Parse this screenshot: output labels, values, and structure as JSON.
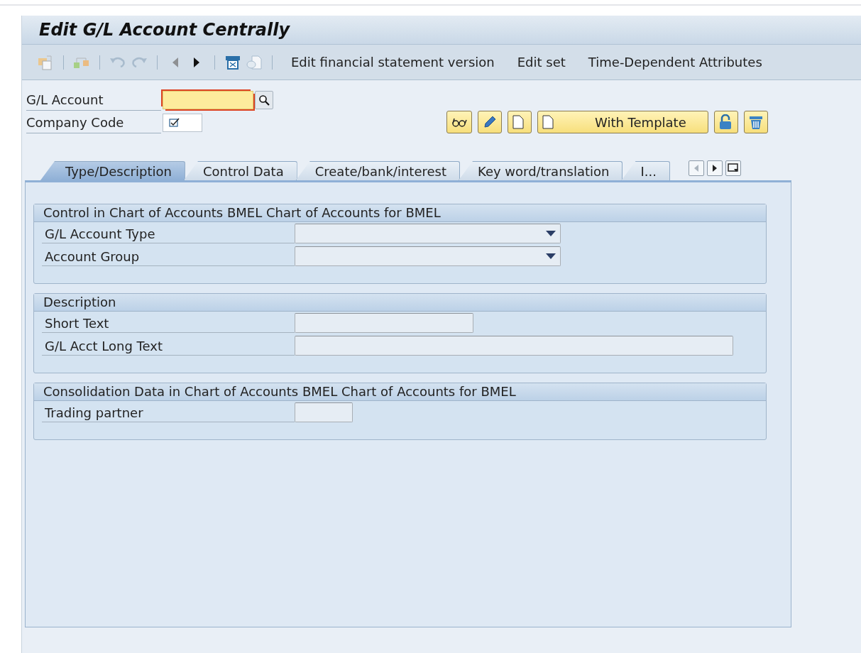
{
  "title": "Edit G/L Account Centrally",
  "toolbar": {
    "groups": [
      [
        {
          "kind": "copy",
          "disabled": true
        }
      ],
      [
        {
          "kind": "hierarchy",
          "disabled": true
        }
      ],
      [
        {
          "kind": "undo",
          "disabled": true
        },
        {
          "kind": "redo",
          "disabled": true
        }
      ],
      [
        {
          "kind": "prev",
          "disabled": true
        },
        {
          "kind": "next",
          "disabled": false
        }
      ],
      [
        {
          "kind": "print",
          "disabled": false
        },
        {
          "kind": "document",
          "disabled": true
        }
      ]
    ],
    "links": [
      "Edit financial statement version",
      "Edit set",
      "Time-Dependent Attributes"
    ]
  },
  "header_fields": [
    {
      "label": "G/L Account",
      "focused": true,
      "search_help": true,
      "required": false
    },
    {
      "label": "Company Code",
      "focused": false,
      "search_help": false,
      "required": true
    }
  ],
  "actions": [
    {
      "kind": "display"
    },
    {
      "kind": "change"
    },
    {
      "kind": "create"
    },
    {
      "kind": "create",
      "label": "With Template"
    },
    {
      "kind": "lock"
    },
    {
      "kind": "delete"
    }
  ],
  "tabs": [
    {
      "label": "Type/Description",
      "selected": true
    },
    {
      "label": "Control Data",
      "selected": false
    },
    {
      "label": "Create/bank/interest",
      "selected": false
    },
    {
      "label": "Key word/translation",
      "selected": false
    },
    {
      "label": "I...",
      "selected": false
    }
  ],
  "tab_nav": [
    {
      "kind": "prev",
      "disabled": true
    },
    {
      "kind": "next",
      "disabled": false
    },
    {
      "kind": "list",
      "disabled": false
    }
  ],
  "sections": [
    {
      "title": "Control in Chart of Accounts BMEL Chart of Accounts for BMEL",
      "rows": [
        {
          "label": "G/L Account Type",
          "kind": "dropdown"
        },
        {
          "label": "Account Group",
          "kind": "dropdown"
        }
      ]
    },
    {
      "title": "Description",
      "rows": [
        {
          "label": "Short Text",
          "kind": "text"
        },
        {
          "label": "G/L Acct Long Text",
          "kind": "longtext"
        }
      ]
    },
    {
      "title": "Consolidation Data in Chart of Accounts BMEL Chart of Accounts for BMEL",
      "rows": [
        {
          "label": "Trading partner",
          "kind": "code"
        }
      ]
    }
  ]
}
